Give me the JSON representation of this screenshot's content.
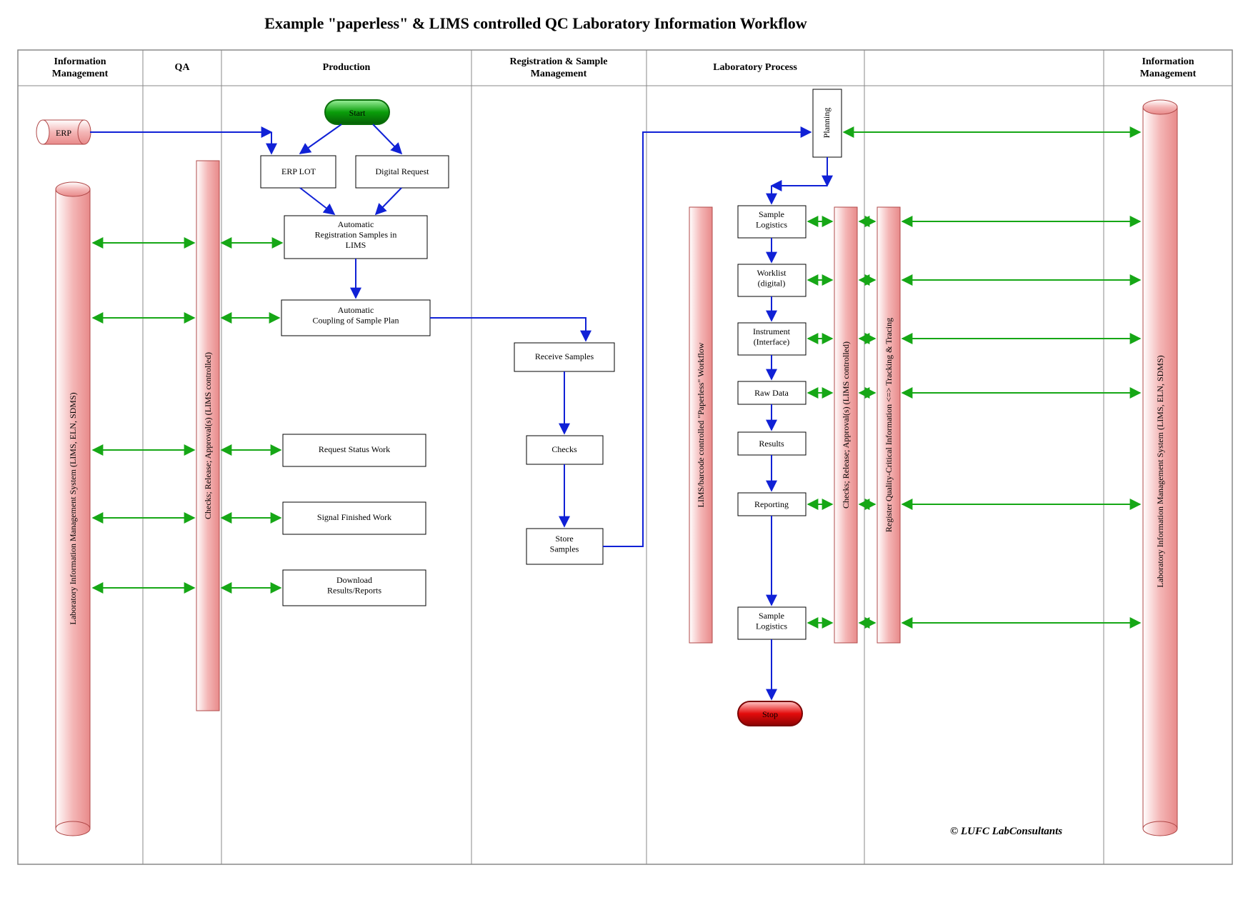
{
  "title": "Example \"paperless\" & LIMS controlled QC Laboratory Information Workflow",
  "lanes": {
    "info_left": "Information\nManagement",
    "qa": "QA",
    "production": "Production",
    "reg_sample": "Registration & Sample\nManagement",
    "lab_process": "Laboratory Process",
    "spacer": "",
    "info_right": "Information\nManagement"
  },
  "nodes": {
    "start": "Start",
    "stop": "Stop",
    "erp": "ERP",
    "erp_lot": "ERP LOT",
    "digital_request": "Digital Request",
    "auto_reg": "Automatic\nRegistration Samples in\nLIMS",
    "auto_coupling": "Automatic\nCoupling of Sample Plan",
    "request_status": "Request Status Work",
    "signal_finished": "Signal Finished Work",
    "download_results": "Download\nResults/Reports",
    "receive_samples": "Receive Samples",
    "checks": "Checks",
    "store_samples": "Store\nSamples",
    "planning": "Planning",
    "sample_logistics1": "Sample\nLogistics",
    "worklist": "Worklist\n(digital)",
    "instrument": "Instrument\n(Interface)",
    "raw_data": "Raw Data",
    "results": "Results",
    "reporting": "Reporting",
    "sample_logistics2": "Sample\nLogistics"
  },
  "vlabels": {
    "lims_left": "Laboratory Information Management System (LIMS, ELN, SDMS)",
    "lims_right": "Laboratory  Information Management System (LIMS, ELN, SDMS)",
    "qa_checks": "Checks; Release; Approval(s) (LIMS controlled)",
    "paperless_wf": "LIMS/barcode controlled \"Paperless\" Workflow",
    "checks2": "Checks; Release; Approval(s) (LIMS controlled)",
    "register_qci": "Register Quality-Critical Information <=> Tracking & Tracing"
  },
  "copyright": "© LUFC LabConsultants"
}
